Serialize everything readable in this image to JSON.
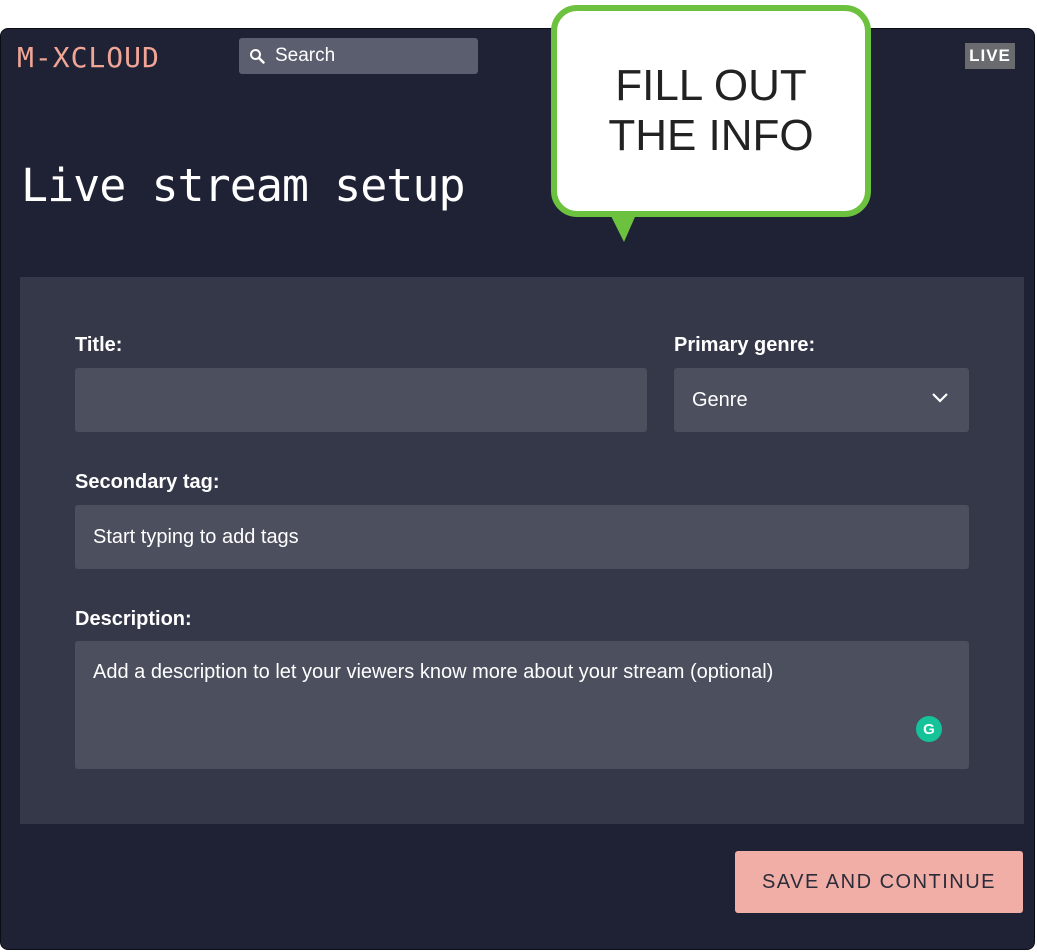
{
  "header": {
    "logo": "M-XCLOUD",
    "search": {
      "placeholder": "Search",
      "icon": "search-icon"
    },
    "live_badge": "LIVE"
  },
  "page": {
    "title": "Live stream setup"
  },
  "callout": {
    "line1": "FILL OUT",
    "line2": "THE INFO",
    "border_color": "#6cc13f"
  },
  "form": {
    "title_label": "Title:",
    "title_value": "",
    "genre_label": "Primary genre:",
    "genre_value": "Genre",
    "secondary_label": "Secondary tag:",
    "secondary_placeholder": "Start typing to add tags",
    "description_label": "Description:",
    "description_placeholder": "Add a description to let your viewers know more about your stream (optional)",
    "grammarly_icon": "grammarly-icon"
  },
  "actions": {
    "save_label": "SAVE AND CONTINUE",
    "accent": "#f1aea6"
  }
}
